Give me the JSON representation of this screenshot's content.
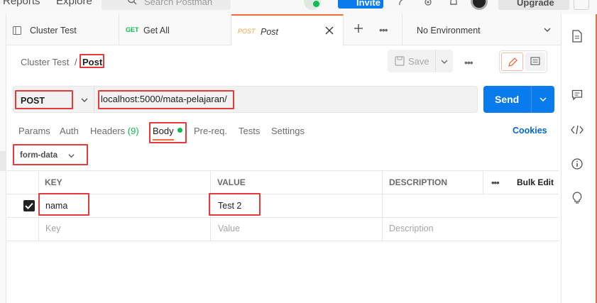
{
  "colors": {
    "accent": "#f26b3a",
    "primary": "#097bed",
    "success": "#0cbb52",
    "highlight": "#e33b3b"
  },
  "topbar": {
    "nav_items": [
      "Reports",
      "Explore"
    ],
    "search_placeholder": "Search Postman",
    "invite_label": "Invite",
    "upgrade_label": "Upgrade",
    "icons": [
      "sync-status-icon",
      "user-plus-icon",
      "satellite-icon",
      "gear-icon",
      "bell-icon",
      "avatar"
    ]
  },
  "tabs": [
    {
      "method": "",
      "name": "Cluster Test",
      "icon": "collection-icon",
      "active": false
    },
    {
      "method": "GET",
      "name": "Get All",
      "active": false
    },
    {
      "method": "POST",
      "name": "Post",
      "active": true
    }
  ],
  "environment": {
    "label": "No Environment"
  },
  "breadcrumb": {
    "parent": "Cluster Test",
    "separator": "/",
    "current": "Post"
  },
  "toolbar": {
    "save_label": "Save"
  },
  "request": {
    "method": "POST",
    "url": "localhost:5000/mata-pelajaran/",
    "send_label": "Send"
  },
  "request_tabs": {
    "params": "Params",
    "auth": "Auth",
    "headers": "Headers",
    "headers_count": "(9)",
    "body": "Body",
    "prereq": "Pre-req.",
    "tests": "Tests",
    "settings": "Settings",
    "cookies": "Cookies"
  },
  "body_type": "form-data",
  "table": {
    "headers": {
      "key": "KEY",
      "value": "VALUE",
      "description": "DESCRIPTION",
      "bulk_edit": "Bulk Edit"
    },
    "rows": [
      {
        "checked": true,
        "key": "nama",
        "value": "Test 2",
        "description": ""
      }
    ],
    "placeholders": {
      "key": "Key",
      "value": "Value",
      "description": "Description"
    }
  },
  "sidebar_icons": [
    "documentation-icon",
    "comments-icon",
    "code-icon",
    "info-icon",
    "lightbulb-icon"
  ]
}
